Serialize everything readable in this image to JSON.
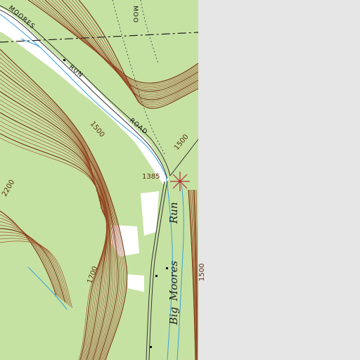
{
  "labels": {
    "road_moores": "MOORES",
    "road_run": "RUN",
    "road_road": "ROAD",
    "road_moo": "MOO",
    "stream_big": "Big",
    "stream_moores": "Moores",
    "stream_run": "Run",
    "spot_elevation": "1385",
    "contour_1500_a": "1500",
    "contour_1500_b": "1500",
    "contour_1500_c": "1500",
    "contour_1700": "1700",
    "contour_2200": "2200"
  },
  "colors": {
    "forest": "#c6e2a2",
    "clearing": "#ffffff",
    "background": "#e6e6e6",
    "contour": "#a0522d",
    "contour_index": "#7a3a18",
    "water": "#3aa0d8",
    "road": "#333333",
    "boundary": "#222222"
  },
  "icons": {
    "benchmark": "cross-in-square-icon"
  }
}
